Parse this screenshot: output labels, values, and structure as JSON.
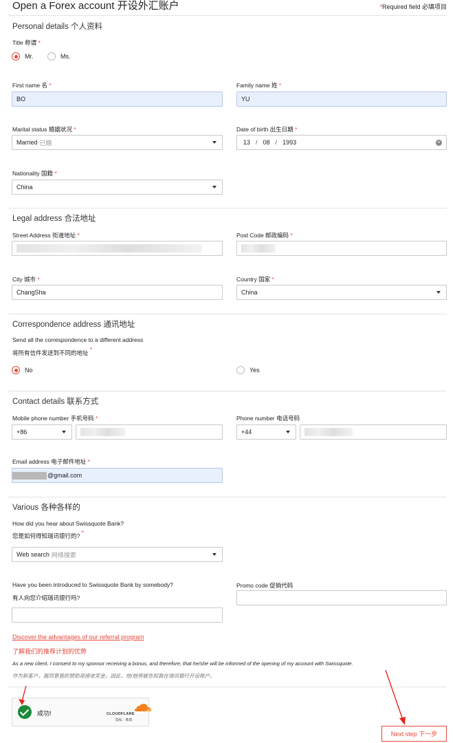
{
  "header": {
    "title": "Open a Forex account 开设外汇账户",
    "required_star": "*",
    "required_note": "Required field 必填项目"
  },
  "personal": {
    "section_title": "Personal details 个人资料",
    "title_label": "Title 称谓",
    "title_options": [
      "Mr.",
      "Ms."
    ],
    "first_name_label": "First name 名",
    "first_name_value": "BO",
    "family_name_label": "Family name 姓",
    "family_name_value": "YU",
    "marital_label": "Marital status 婚姻状况",
    "marital_value": "Married",
    "marital_value_cn": "已婚",
    "dob_label": "Date of birth 出生日期",
    "dob_day": "13",
    "dob_month": "08",
    "dob_year": "1993",
    "dob_sep": "/",
    "nationality_label": "Nationality 国籍",
    "nationality_value": "China"
  },
  "legal": {
    "section_title": "Legal address 合法地址",
    "street_label": "Street Address 街道地址",
    "postcode_label": "Post Code 邮政编码",
    "city_label": "City 城市",
    "city_value": "ChangSha",
    "country_label": "Country 国家",
    "country_value": "China"
  },
  "correspondence": {
    "section_title": "Correspondence address 通讯地址",
    "question_en": "Send all the correspondence to a different address",
    "question_cn": "将所有信件发送到不同的地址",
    "options": [
      "No",
      "Yes"
    ]
  },
  "contact": {
    "section_title": "Contact details 联系方式",
    "mobile_label": "Mobile phone number 手机号码",
    "mobile_code": "+86",
    "phone_label": "Phone number 电话号码",
    "phone_code": "+44",
    "email_label": "Email address 电子邮件地址",
    "email_value": "@gmail.com"
  },
  "various": {
    "section_title": "Various 各种各样的",
    "hear_label_en": "How did you hear about Swissquote Bank?",
    "hear_label_cn": "您是如何得知瑞讯银行的?",
    "hear_value": "Web search",
    "hear_value_cn": "网络搜索",
    "introduced_label_en": "Have you been introduced to Swissquote Bank by somebody?",
    "introduced_label_cn": "有人向您介绍瑞讯银行吗?",
    "promo_label": "Promo code 促销代码",
    "referral_link_en": "Discover the advantages of our referral program",
    "referral_link_cn": "了解我们的推荐计划的优势",
    "consent_en": "As a new client, I consent to my sponsor receiving a bonus, and therefore, that he/she will be informed of the opening of my account with Swissquote.",
    "consent_cn": "作为新客户，我同意我的赞助商接收奖金，因此，他/她将被告知我在瑞讯银行开设账户。"
  },
  "captcha": {
    "success_text": "成功!",
    "brand": "CLOUDFLARE",
    "links": "隐私 · 条款"
  },
  "footer": {
    "next_label": "Next step 下一步"
  },
  "colors": {
    "accent": "#e5483a",
    "autofill": "#e8f0fe",
    "success": "#1a8a3a",
    "cloudflare": "#f38020"
  }
}
